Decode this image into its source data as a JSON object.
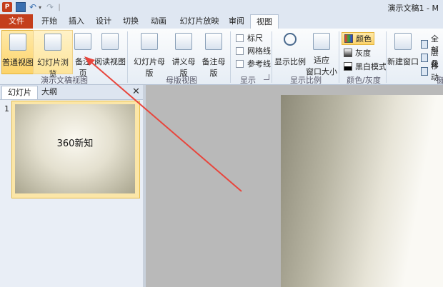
{
  "window": {
    "title": "演示文稿1 - M"
  },
  "app_logo": "P",
  "quick_access": {
    "undo_symbol": "↶",
    "undo_dropdown": "▾",
    "redo_symbol": "↷",
    "separator": "|"
  },
  "tabs": [
    "文件",
    "开始",
    "插入",
    "设计",
    "切换",
    "动画",
    "幻灯片放映",
    "审阅",
    "视图"
  ],
  "ribbon": {
    "presentation_views": {
      "label": "演示文稿视图",
      "buttons": [
        "普通视图",
        "幻灯片浏览",
        "备注页",
        "阅读视图"
      ]
    },
    "master_views": {
      "label": "母版视图",
      "buttons": [
        "幻灯片母版",
        "讲义母版",
        "备注母版"
      ]
    },
    "show": {
      "label": "显示",
      "options": [
        "标尺",
        "网格线",
        "参考线"
      ]
    },
    "zoom": {
      "label": "显示比例",
      "zoom_button": "显示比例",
      "fit_line1": "适应",
      "fit_line2": "窗口大小"
    },
    "color": {
      "label": "颜色/灰度",
      "options": [
        "颜色",
        "灰度",
        "黑白模式"
      ]
    },
    "window": {
      "new_window": "新建窗口",
      "items": [
        "全部",
        "层叠",
        "移动"
      ],
      "label_partial": "窗"
    }
  },
  "colors": {
    "file_tab": "#c43e1c",
    "active_button": "#fcd36a",
    "arrow": "#e8453c"
  },
  "pane": {
    "tabs": [
      "幻灯片",
      "大纲"
    ],
    "close": "✕",
    "slide_number": "1",
    "thumbnail_text": "360新知"
  }
}
